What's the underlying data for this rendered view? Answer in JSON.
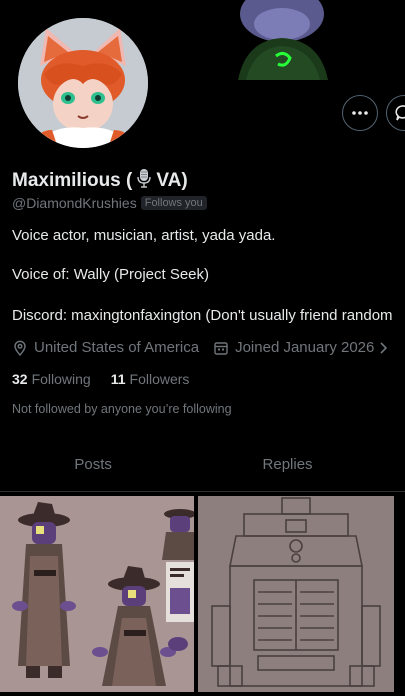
{
  "profile": {
    "display_name": "Maximilious (",
    "display_name_suffix": "VA)",
    "handle": "@DiamondKrushies",
    "follows_you": "Follows you",
    "bio_line1": "Voice actor, musician, artist, yada yada.",
    "bio_line2": "Voice of: Wally (Project Seek)",
    "bio_line3": "Discord: maxingtonfaxington (Don't usually friend random",
    "location": "United States of America",
    "joined": "Joined January 2026",
    "following_count": "32",
    "following_label": "Following",
    "followers_count": "11",
    "followers_label": "Followers",
    "not_followed_text": "Not followed by anyone you’re following"
  },
  "tabs": {
    "posts": "Posts",
    "replies": "Replies"
  },
  "colors": {
    "background": "#000000",
    "primary_text": "#e7e9ea",
    "secondary_text": "#71767b",
    "border": "#2f3336"
  },
  "icons": [
    "microphone-icon",
    "more-icon",
    "message-icon",
    "location-icon",
    "calendar-icon",
    "chevron-right-icon"
  ]
}
